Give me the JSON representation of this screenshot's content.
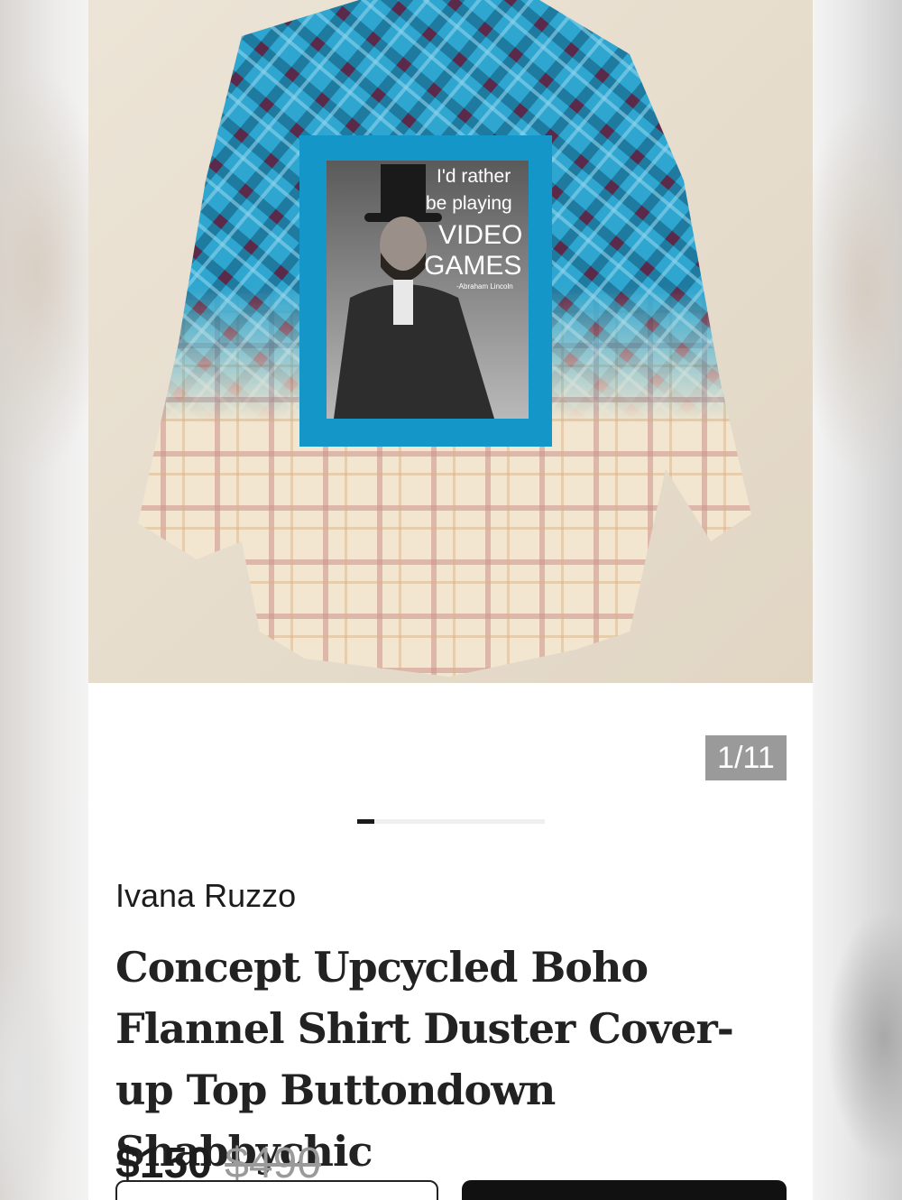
{
  "gallery": {
    "counter": "1/11",
    "current_index": 1,
    "total_images": 11,
    "progress_fraction": 0.09,
    "photo_patch_text": {
      "line1": "I'd rather",
      "line2": "be playing",
      "line3": "VIDEO",
      "line4": "GAMES",
      "attribution": "-Abraham Lincoln"
    }
  },
  "product": {
    "seller": "Ivana Ruzzo",
    "title": "Concept Upcycled Boho Flannel Shirt Duster Cover-up Top Buttondown Shabbychic",
    "price": "$150",
    "original_price": "$490"
  },
  "colors": {
    "accent": "#111111",
    "counter_bg": "#9a9a9a",
    "patch_blue": "#1596c9"
  }
}
